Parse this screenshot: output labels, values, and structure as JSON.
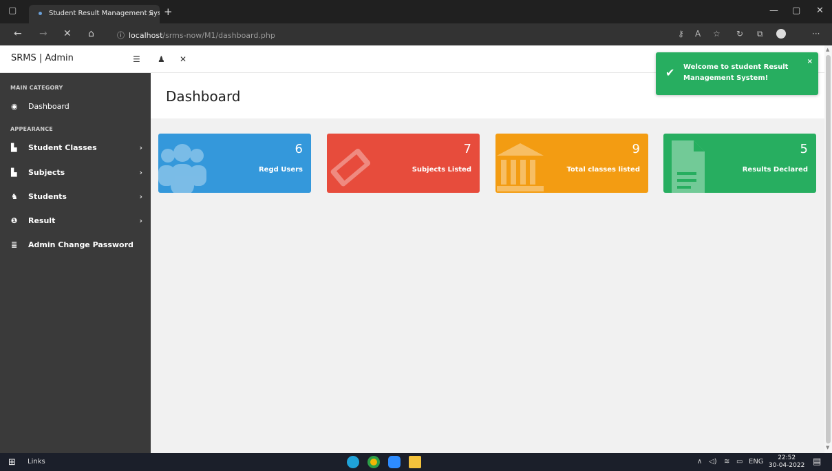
{
  "browser": {
    "tab_title": "Student Result Management Sys",
    "tab_close": "×",
    "new_tab": "+",
    "url_host": "localhost",
    "url_path": "/srms-now/M1/dashboard.php",
    "url_info": "ⓘ"
  },
  "header": {
    "brand": "SRMS | Admin"
  },
  "sidebar": {
    "categories": [
      "MAIN CATEGORY",
      "APPEARANCE"
    ],
    "dashboard": "Dashboard",
    "items": [
      {
        "label": "Student Classes",
        "icon": "file-icon"
      },
      {
        "label": "Subjects",
        "icon": "file-icon"
      },
      {
        "label": "Students",
        "icon": "users-icon"
      },
      {
        "label": "Result",
        "icon": "info-icon"
      },
      {
        "label": "Admin Change Password",
        "icon": "list-icon"
      }
    ]
  },
  "main": {
    "title": "Dashboard",
    "stats": [
      {
        "value": "6",
        "label": "Regd Users",
        "color": "#3498db"
      },
      {
        "value": "7",
        "label": "Subjects Listed",
        "color": "#e74c3c"
      },
      {
        "value": "9",
        "label": "Total classes listed",
        "color": "#f39c12"
      },
      {
        "value": "5",
        "label": "Results Declared",
        "color": "#27ae60"
      }
    ]
  },
  "toast": {
    "message": "Welcome to student Result Management System!",
    "close": "×",
    "color": "#27ae60"
  },
  "taskbar": {
    "links": "Links",
    "lang": "ENG",
    "time": "22:52",
    "date": "30-04-2022"
  }
}
